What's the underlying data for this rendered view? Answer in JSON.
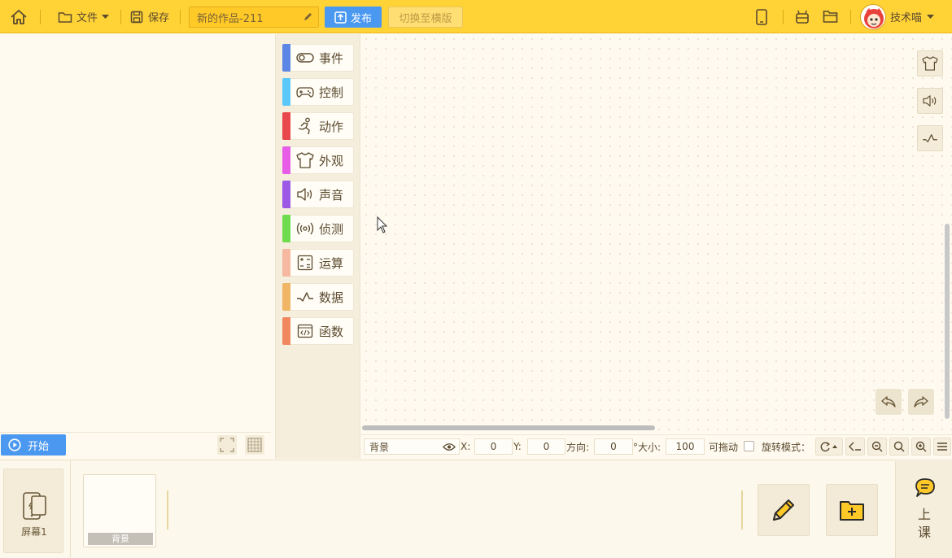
{
  "toolbar": {
    "file_label": "文件",
    "save_label": "保存",
    "project_title": "新的作品-211",
    "publish_label": "发布",
    "switch_orientation_label": "切换至横版",
    "user_name": "技术喵"
  },
  "categories": [
    {
      "label": "事件",
      "color": "#5b86e5",
      "icon": "toggle-icon"
    },
    {
      "label": "控制",
      "color": "#5ac8fa",
      "icon": "gamepad-icon"
    },
    {
      "label": "动作",
      "color": "#e8484b",
      "icon": "running-icon"
    },
    {
      "label": "外观",
      "color": "#e85de8",
      "icon": "shirt-icon"
    },
    {
      "label": "声音",
      "color": "#9b59e6",
      "icon": "speaker-icon"
    },
    {
      "label": "侦测",
      "color": "#6fdc4e",
      "icon": "signal-icon"
    },
    {
      "label": "运算",
      "color": "#f6b8a0",
      "icon": "calculator-icon"
    },
    {
      "label": "数据",
      "color": "#f0b565",
      "icon": "chart-line-icon"
    },
    {
      "label": "函数",
      "color": "#f0875e",
      "icon": "code-icon"
    }
  ],
  "stage": {
    "start_label": "开始"
  },
  "properties": {
    "sprite_name": "背景",
    "x_label": "X:",
    "x_value": "0",
    "y_label": "Y:",
    "y_value": "0",
    "direction_label": "方向:",
    "direction_value": "0",
    "size_label": "°大小:",
    "size_value": "100",
    "draggable_label": "可拖动",
    "rotation_label": "旋转模式："
  },
  "bottom": {
    "screen_label": "屏幕1",
    "background_label": "背景",
    "lesson_label_1": "上",
    "lesson_label_2": "课"
  },
  "colors": {
    "topbar": "#ffd236",
    "accent_blue": "#4a98f0"
  }
}
